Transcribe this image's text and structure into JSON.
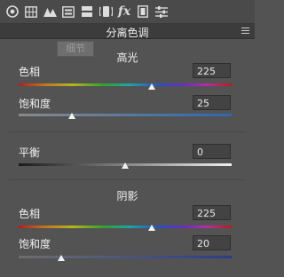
{
  "toolbar": {
    "icons": [
      "aperture-icon",
      "grid-icon",
      "mountains-icon",
      "bars-icon",
      "split-toning-icon",
      "lens-icon",
      "fx-icon",
      "film-strip-icon",
      "sliders-icon"
    ],
    "fx_label": "fx"
  },
  "panel": {
    "title": "分离色调",
    "tooltip": "细节"
  },
  "highlights": {
    "title": "高光",
    "hue": {
      "label": "色相",
      "value": "225"
    },
    "saturation": {
      "label": "饱和度",
      "value": "25"
    }
  },
  "balance": {
    "label": "平衡",
    "value": "0"
  },
  "shadows": {
    "title": "阴影",
    "hue": {
      "label": "色相",
      "value": "225"
    },
    "saturation": {
      "label": "饱和度",
      "value": "20"
    }
  }
}
